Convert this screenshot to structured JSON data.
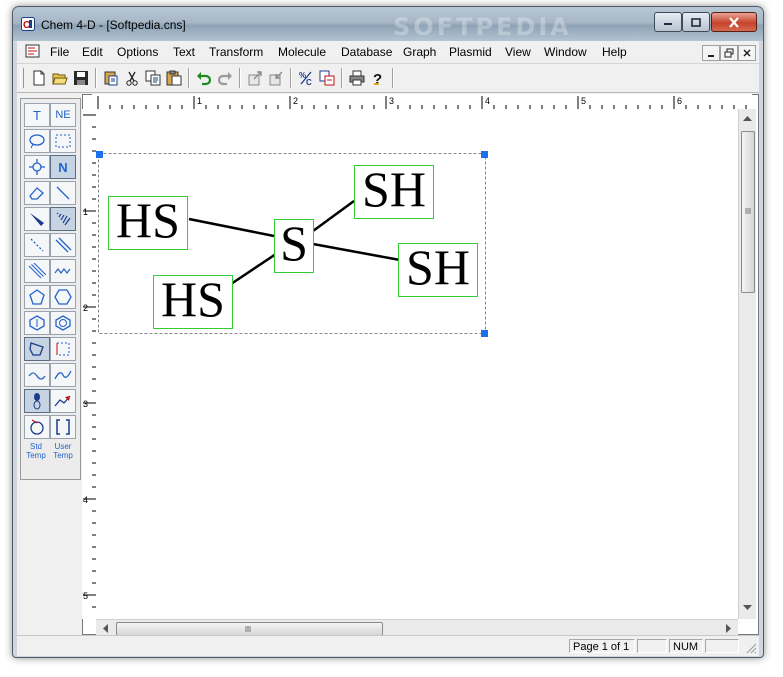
{
  "window": {
    "title": "Chem 4-D - [Softpedia.cns]",
    "watermark": "SOFTPEDIA",
    "controls": [
      "minimize-icon",
      "maximize-icon",
      "close-icon"
    ]
  },
  "menubar": {
    "items": [
      "File",
      "Edit",
      "Options",
      "Text",
      "Transform",
      "Molecule",
      "Database",
      "Graph",
      "Plasmid",
      "View",
      "Window",
      "Help"
    ],
    "mdi_controls": [
      "mdi-minimize-icon",
      "mdi-restore-icon",
      "mdi-close-icon"
    ]
  },
  "toolbar": {
    "buttons": [
      "new-icon",
      "open-icon",
      "save-icon",
      "paste-special-icon",
      "cut-icon",
      "copy-icon",
      "paste-icon",
      "undo-icon",
      "redo-icon",
      "export-icon",
      "import-icon",
      "fraction-icon",
      "convert-icon",
      "print-icon",
      "help-icon"
    ]
  },
  "palette": {
    "text_tool": "T",
    "ne_tool": "NE",
    "n_tool": "N",
    "std_temp": "Std Temp",
    "user_temp": "User Temp"
  },
  "ruler": {
    "top_labels": [
      "1",
      "2",
      "3",
      "4",
      "5",
      "6"
    ],
    "left_labels": [
      "1",
      "2",
      "3",
      "4",
      "5"
    ]
  },
  "molecule": {
    "atoms": [
      {
        "id": "hs-top",
        "label": "HS"
      },
      {
        "id": "hs-bottom",
        "label": "HS"
      },
      {
        "id": "s-center",
        "label": "S"
      },
      {
        "id": "sh-top",
        "label": "SH"
      },
      {
        "id": "sh-right",
        "label": "SH"
      }
    ]
  },
  "status": {
    "page": "Page 1 of 1",
    "num": "NUM"
  },
  "colors": {
    "atom_box": "#33cc33",
    "selection_handle": "#1e6ff0",
    "palette_icon": "#2563c8"
  }
}
